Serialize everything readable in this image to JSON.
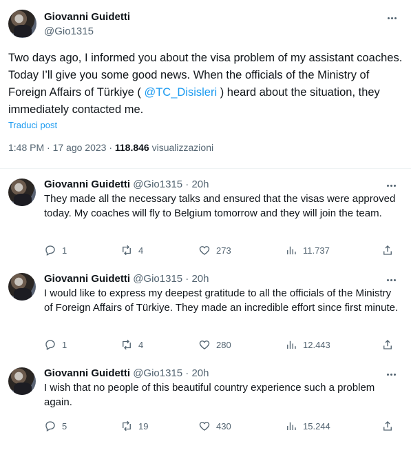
{
  "main_tweet": {
    "author_name": "Giovanni Guidetti",
    "author_handle": "@Gio1315",
    "text_part1": "Two days ago, I informed you about the visa problem of my assistant coaches. Today I’ll give you some good news. When the officials of the Ministry of Foreign Affairs of Türkiye ( ",
    "mention": "@TC_Disisleri",
    "text_part2": " ) heard about the situation, they immediately contacted me.",
    "translate_label": "Traduci post",
    "time": "1:48 PM · 17 ago 2023 · ",
    "views_count": "118.846",
    "views_label": " visualizzazioni"
  },
  "replies": [
    {
      "author_name": "Giovanni Guidetti",
      "author_handle": "@Gio1315 · 20h",
      "text": "They made all the necessary talks and ensured that the visas were approved today. My coaches will fly to Belgium tomorrow and they will join the team.",
      "replies_count": "1",
      "reposts_count": "4",
      "likes_count": "273",
      "views_count": "11.737"
    },
    {
      "author_name": "Giovanni Guidetti",
      "author_handle": "@Gio1315 · 20h",
      "text": "I would like to express my deepest gratitude to all the officials of the Ministry of Foreign Affairs of Türkiye. They made an incredible effort since first minute.",
      "replies_count": "1",
      "reposts_count": "4",
      "likes_count": "280",
      "views_count": "12.443"
    },
    {
      "author_name": "Giovanni Guidetti",
      "author_handle": "@Gio1315 · 20h",
      "text": "I wish that no people of this beautiful country experience such a problem again.",
      "replies_count": "5",
      "reposts_count": "19",
      "likes_count": "430",
      "views_count": "15.244"
    }
  ],
  "icons": {
    "more": "more-horizontal-icon",
    "reply": "reply-icon",
    "repost": "repost-icon",
    "like": "like-icon",
    "views": "views-icon",
    "share": "share-icon"
  },
  "colors": {
    "link": "#1d9bf0",
    "secondary_text": "#536471",
    "primary_text": "#0f1419",
    "divider": "#eff3f4"
  }
}
